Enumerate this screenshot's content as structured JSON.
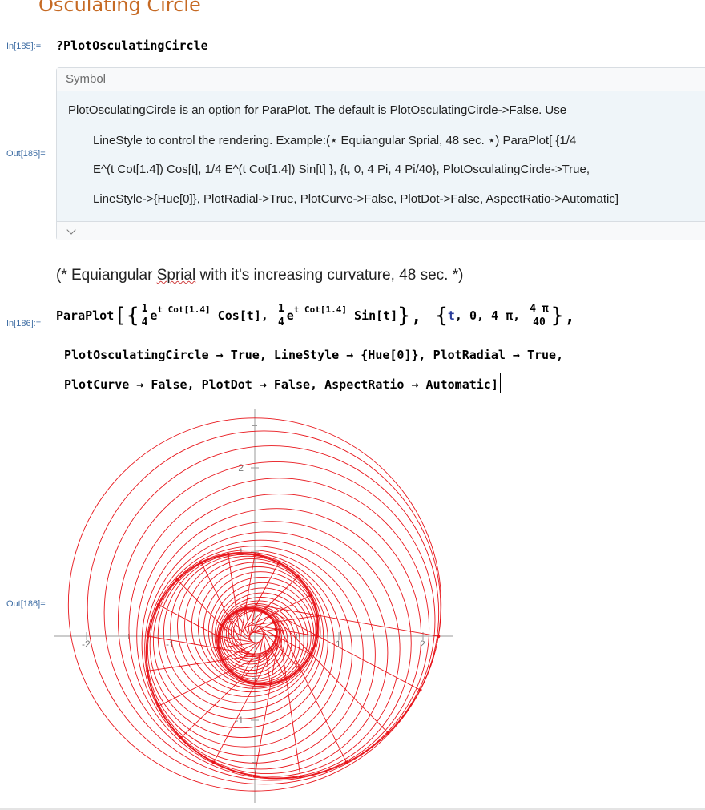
{
  "title": "Osculating Circle",
  "cell1": {
    "in_label": "In[185]:=",
    "code": "?PlotOsculatingCircle",
    "out_label": "Out[185]=",
    "symbol_header": "Symbol",
    "usage_lines": [
      "PlotOsculatingCircle is an option for ParaPlot. The default is PlotOsculatingCircle->False. Use",
      "LineStyle to control the rendering. Example:(⋆ Equiangular Sprial, 48 sec. ⋆) ParaPlot[ {1/4",
      "E^(t Cot[1.4]) Cos[t], 1/4 E^(t Cot[1.4]) Sin[t] }, {t, 0, 4 Pi, 4 Pi/40}, PlotOsculatingCircle->True,",
      "LineStyle->{Hue[0]}, PlotRadial->True, PlotCurve->False, PlotDot->False, AspectRatio->Automatic]"
    ]
  },
  "comment": {
    "before": "(* Equiangular ",
    "misspelled": "Sprial",
    "after": " with it's increasing curvature, 48 sec. *)"
  },
  "cell2": {
    "in_label": "In[186]:=",
    "out_label": "Out[186]=",
    "tokens": {
      "paraplot": "ParaPlot",
      "open": "[{",
      "frac_num": "1",
      "frac_den": "4",
      "e": "e",
      "exponent": "t Cot[1.4]",
      "cos": " Cos[t], ",
      "sin": " Sin[t]",
      "close1": "}, ",
      "brace_open": "{",
      "t": "t",
      "range": ", 0, 4 π, ",
      "step_num": "4 π",
      "step_den": "40",
      "brace_close": "},",
      "line2": "PlotOsculatingCircle → True, LineStyle → {Hue[0]}, PlotRadial → True,",
      "line3": "PlotCurve → False, PlotDot → False, AspectRatio → Automatic]"
    },
    "plot": {
      "color": "#e8141a",
      "axis_color": "#999999",
      "x_ticks": [
        "-2",
        "-1",
        "1",
        "2"
      ],
      "y_ticks": [
        "2",
        "1",
        "-1"
      ],
      "xlim": [
        -2.35,
        2.35
      ],
      "ylim": [
        -2.15,
        2.6
      ],
      "curve": "1/4 e^(t Cot[1.4]) {Cos[t], Sin[t]}",
      "t_range": [
        0,
        12.566
      ],
      "samples": 41
    }
  }
}
